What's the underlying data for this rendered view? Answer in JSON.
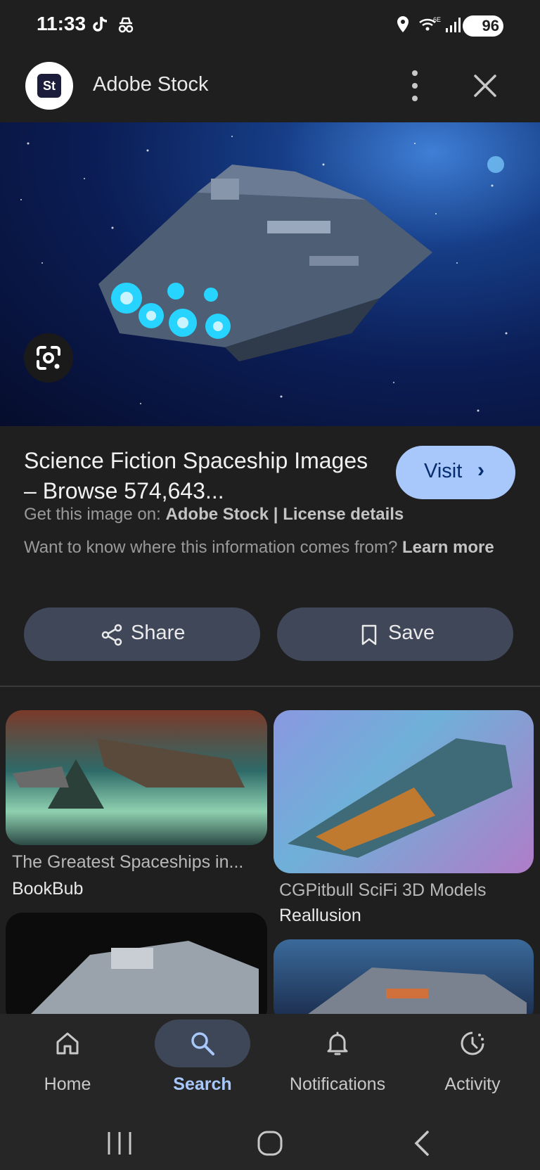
{
  "status_bar": {
    "time": "11:33",
    "battery": "96",
    "network": "6E"
  },
  "header": {
    "site_logo_text": "St",
    "site_name": "Adobe Stock"
  },
  "result": {
    "title": "Science Fiction Spaceship Images – Browse 574,643...",
    "visit_label": "Visit",
    "get_image_prefix": "Get this image on:",
    "source": "Adobe Stock",
    "separator": "|",
    "license_label": "License details",
    "info_text": "Want to know where this information comes from?",
    "learn_more": "Learn more",
    "share_label": "Share",
    "save_label": "Save"
  },
  "related": [
    {
      "title": "The Greatest Spaceships in...",
      "source": "BookBub"
    },
    {
      "title": "CGPitbull SciFi 3D Models",
      "source": "Reallusion"
    }
  ],
  "bottom_nav": {
    "items": [
      {
        "label": "Home",
        "icon": "home-icon"
      },
      {
        "label": "Search",
        "icon": "search-icon",
        "active": true
      },
      {
        "label": "Notifications",
        "icon": "bell-icon"
      },
      {
        "label": "Activity",
        "icon": "activity-icon"
      }
    ]
  },
  "colors": {
    "background": "#1f1f1f",
    "accent": "#a8c7fa",
    "pill": "#3f4758"
  }
}
